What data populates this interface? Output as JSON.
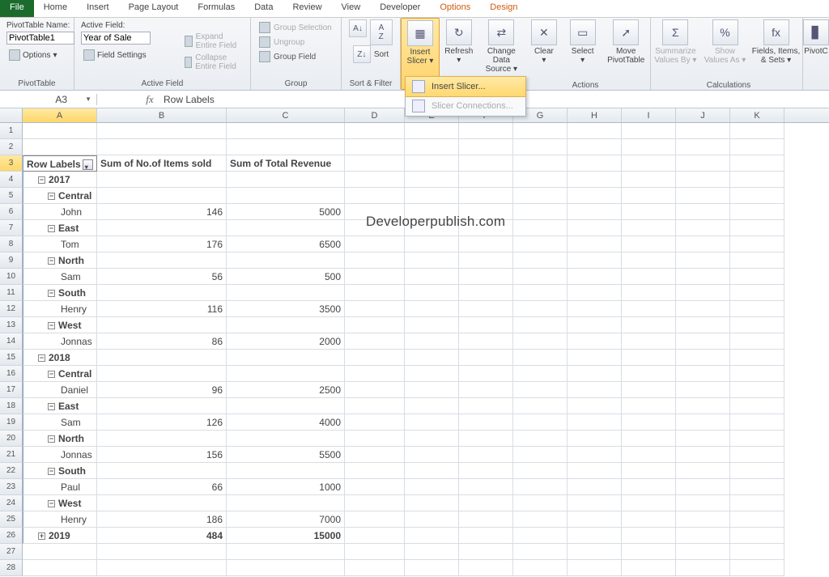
{
  "tabs": {
    "file": "File",
    "home": "Home",
    "insert": "Insert",
    "pageLayout": "Page Layout",
    "formulas": "Formulas",
    "data": "Data",
    "review": "Review",
    "view": "View",
    "developer": "Developer",
    "options": "Options",
    "design": "Design"
  },
  "ribbon": {
    "pvt": {
      "label": "PivotTable Name:",
      "value": "PivotTable1",
      "options": "Options",
      "group": "PivotTable"
    },
    "af": {
      "label": "Active Field:",
      "value": "Year of Sale",
      "fieldSettings": "Field Settings",
      "expand": "Expand Entire Field",
      "collapse": "Collapse Entire Field",
      "group": "Active Field"
    },
    "grp": {
      "sel": "Group Selection",
      "ungrp": "Ungroup",
      "fld": "Group Field",
      "group": "Group"
    },
    "sort": {
      "sort": "Sort",
      "group": "Sort & Filter"
    },
    "slicer": {
      "insert": "Insert",
      "slicer": "Slicer",
      "menuInsert": "Insert Slicer...",
      "menuConn": "Slicer Connections..."
    },
    "actions": {
      "refresh": "Refresh",
      "changeData": "Change Data",
      "source": "Source",
      "clear": "Clear",
      "select": "Select",
      "move": "Move",
      "pivotTable": "PivotTable",
      "group": "Actions"
    },
    "calc": {
      "summarize": "Summarize",
      "valuesBy": "Values By",
      "show": "Show",
      "valuesAs": "Values As",
      "fields": "Fields, Items,",
      "sets": "& Sets",
      "group": "Calculations"
    },
    "pivotchart": "PivotC"
  },
  "namebox": "A3",
  "formula": "Row Labels",
  "cols": {
    "a": "A",
    "b": "B",
    "c": "C",
    "d": "D",
    "e": "E",
    "f": "F",
    "g": "G",
    "h": "H",
    "i": "I",
    "j": "J",
    "k": "K"
  },
  "overlay": "Developerpublish.com",
  "data": {
    "hdr": {
      "rowLabels": "Row Labels",
      "items": "Sum of No.of Items sold",
      "rev": "Sum of Total Revenue"
    },
    "y2017": "2017",
    "y2018": "2018",
    "y2019": "2019",
    "central": "Central",
    "east": "East",
    "north": "North",
    "south": "South",
    "west": "West",
    "john": "John",
    "tom": "Tom",
    "sam": "Sam",
    "henry": "Henry",
    "jonnas": "Jonnas",
    "daniel": "Daniel",
    "paul": "Paul",
    "v": {
      "r6b": "146",
      "r6c": "5000",
      "r8b": "176",
      "r8c": "6500",
      "r10b": "56",
      "r10c": "500",
      "r12b": "116",
      "r12c": "3500",
      "r14b": "86",
      "r14c": "2000",
      "r17b": "96",
      "r17c": "2500",
      "r19b": "126",
      "r19c": "4000",
      "r21b": "156",
      "r21c": "5500",
      "r23b": "66",
      "r23c": "1000",
      "r25b": "186",
      "r25c": "7000",
      "r26b": "484",
      "r26c": "15000"
    }
  }
}
